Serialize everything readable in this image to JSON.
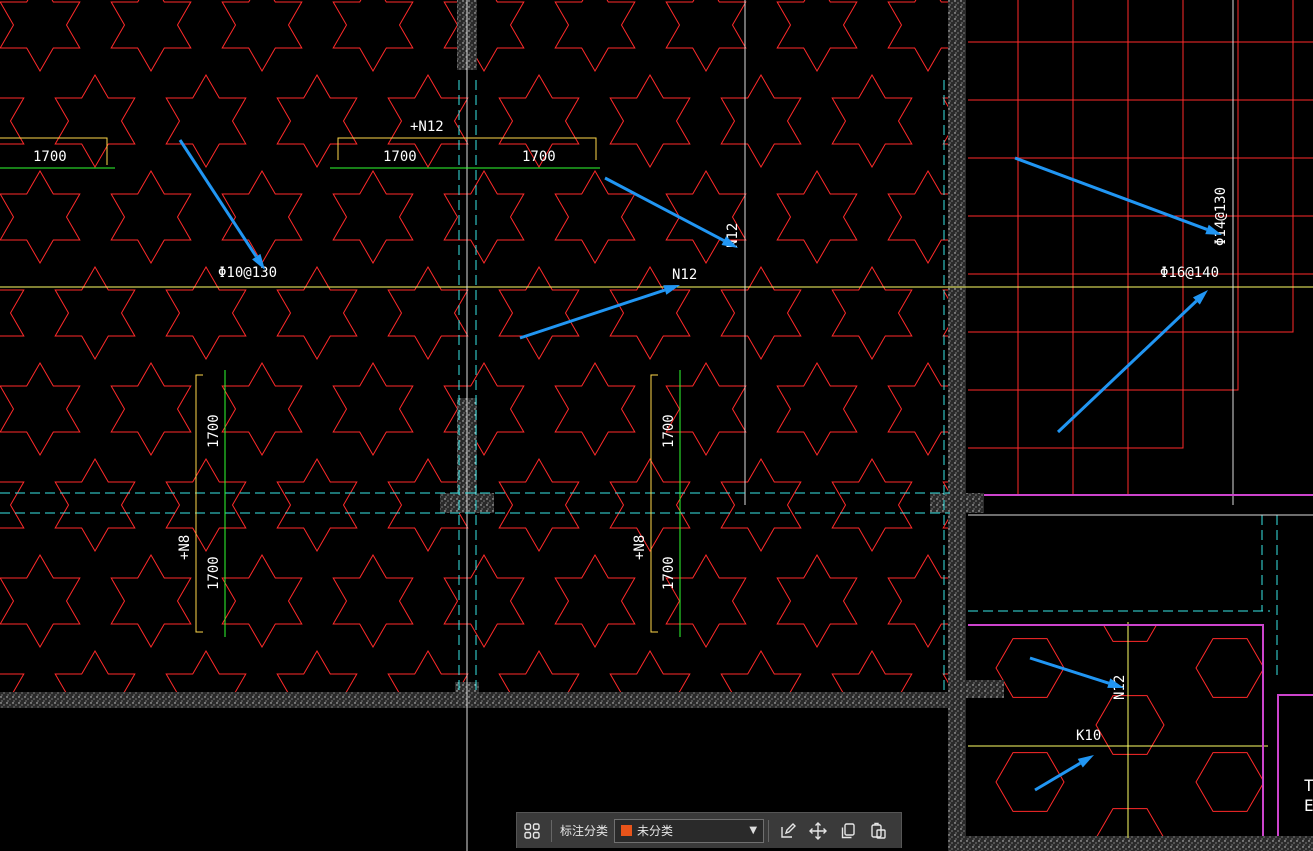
{
  "drawing": {
    "dim_labels": [
      "1700",
      "1700",
      "1700",
      "1700",
      "1700",
      "1700",
      "1700"
    ],
    "rebar_labels": {
      "n12_top": "+N12",
      "phi10": "Φ10@130",
      "n12_mid": "N12",
      "n12_vertical": "N12",
      "phi14": "Φ14@130",
      "phi16": "Φ16@140",
      "n8_left": "+N8",
      "n8_right": "+N8",
      "n12_lower": "N12",
      "k10": "K10",
      "edge_t": "T",
      "edge_e": "E"
    },
    "colors": {
      "background": "#000000",
      "hatch_star": "#ff2a2a",
      "hatch_step": "#ff2a2a",
      "hatch_hex": "#ff2a2a",
      "dimension": "#ffd84a",
      "dim_tick": "#31ff31",
      "axis": "#ffff66",
      "dashed_line": "#39e6e6",
      "boundary_purple": "#cc44cc",
      "wall_fill": "#d0d0d0",
      "arrow": "#2196f3"
    }
  },
  "toolbar": {
    "grid_icon": "grid-icon",
    "label": "标注分类",
    "category_value": "未分类",
    "category_color": "#e8541a",
    "edit_icon": "edit-icon",
    "move_icon": "move-icon",
    "copy_icon": "copy-icon",
    "paste_icon": "paste-icon"
  }
}
